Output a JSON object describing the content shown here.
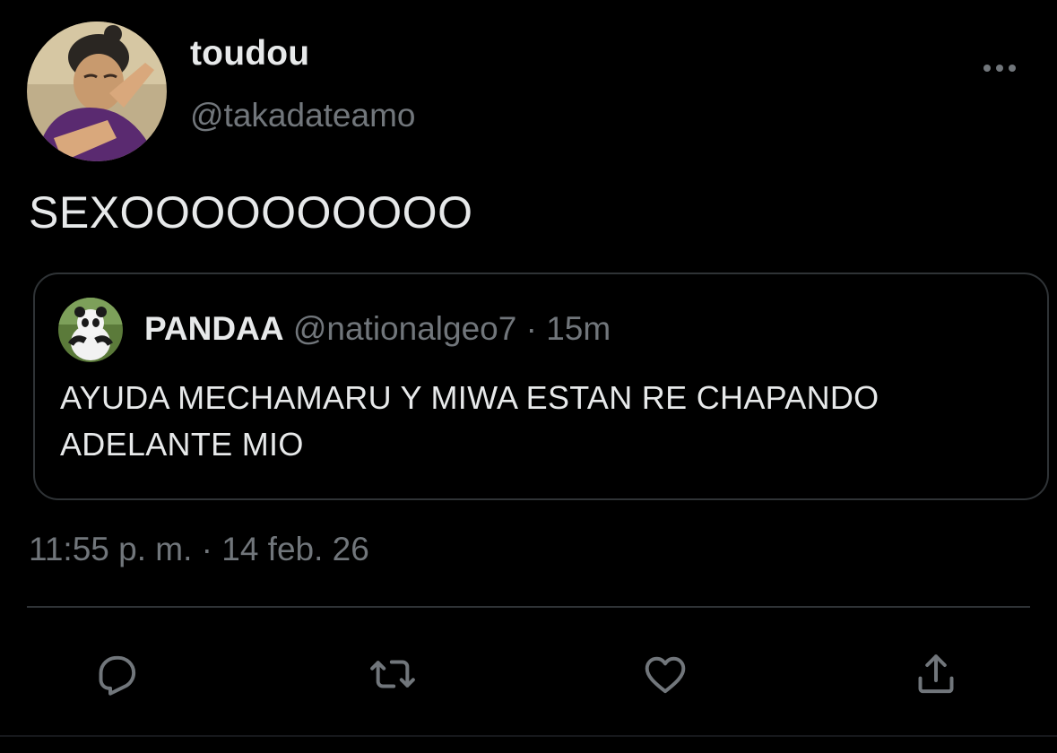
{
  "author": {
    "display_name": "toudou",
    "handle": "@takadateamo"
  },
  "tweet": {
    "text": "SEXOOOOOOOOOO",
    "timestamp": "11:55 p. m. · 14 feb. 26"
  },
  "quoted": {
    "display_name": "PANDAA",
    "handle": "@nationalgeo7",
    "separator": "·",
    "time": "15m",
    "text": "AYUDA MECHAMARU Y MIWA ESTAN RE CHAPANDO ADELANTE MIO"
  },
  "icons": {
    "more": "more-horizontal-icon",
    "reply": "reply-icon",
    "retweet": "retweet-icon",
    "like": "heart-icon",
    "share": "share-icon"
  },
  "colors": {
    "background": "#000000",
    "primary_text": "#e7e9ea",
    "secondary_text": "#71767b",
    "border": "#2f3336"
  }
}
